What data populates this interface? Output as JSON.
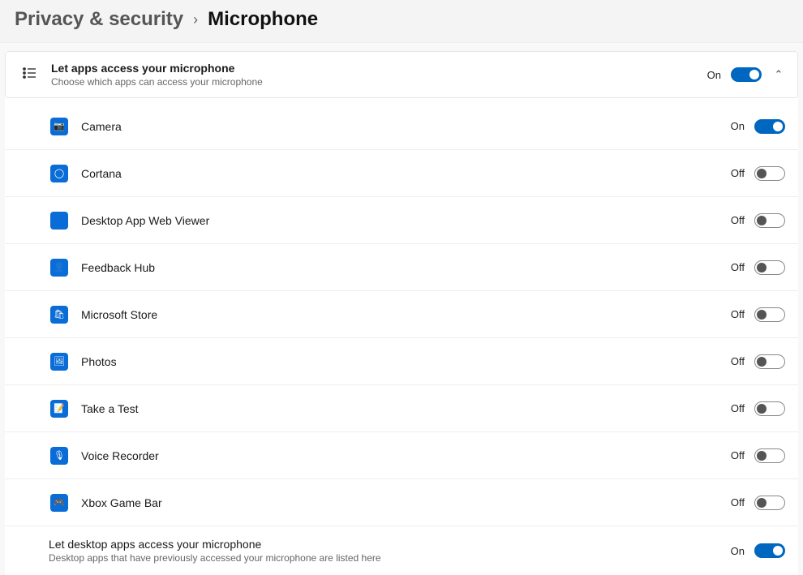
{
  "breadcrumb": {
    "parent": "Privacy & security",
    "current": "Microphone"
  },
  "master": {
    "title": "Let apps access your microphone",
    "subtitle": "Choose which apps can access your microphone",
    "state": "On",
    "toggled": true
  },
  "apps": [
    {
      "name": "Camera",
      "state": "On",
      "toggled": true,
      "iconGlyph": "📷"
    },
    {
      "name": "Cortana",
      "state": "Off",
      "toggled": false,
      "iconGlyph": "◯"
    },
    {
      "name": "Desktop App Web Viewer",
      "state": "Off",
      "toggled": false,
      "iconGlyph": ""
    },
    {
      "name": "Feedback Hub",
      "state": "Off",
      "toggled": false,
      "iconGlyph": "👤"
    },
    {
      "name": "Microsoft Store",
      "state": "Off",
      "toggled": false,
      "iconGlyph": "🛍"
    },
    {
      "name": "Photos",
      "state": "Off",
      "toggled": false,
      "iconGlyph": "🖼"
    },
    {
      "name": "Take a Test",
      "state": "Off",
      "toggled": false,
      "iconGlyph": "📝"
    },
    {
      "name": "Voice Recorder",
      "state": "Off",
      "toggled": false,
      "iconGlyph": "🎙"
    },
    {
      "name": "Xbox Game Bar",
      "state": "Off",
      "toggled": false,
      "iconGlyph": "🎮"
    }
  ],
  "desktopApps": {
    "title": "Let desktop apps access your microphone",
    "subtitle": "Desktop apps that have previously accessed your microphone are listed here",
    "state": "On",
    "toggled": true
  }
}
